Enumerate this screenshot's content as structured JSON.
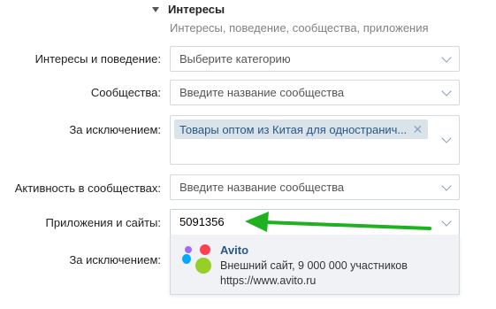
{
  "section": {
    "title": "Интересы",
    "subtitle": "Интересы, поведение, сообщества, приложения"
  },
  "rows": {
    "interests": {
      "label": "Интересы и поведение:",
      "placeholder": "Выберите категорию"
    },
    "communities": {
      "label": "Сообщества:",
      "placeholder": "Введите название сообщества"
    },
    "except1": {
      "label": "За исключением:",
      "token": "Товары оптом из Китая для одностранич..."
    },
    "activity": {
      "label": "Активность в сообществах:",
      "placeholder": "Введите название сообщества"
    },
    "apps": {
      "label": "Приложения и сайты:",
      "value": "5091356"
    },
    "except2": {
      "label": "За исключением:"
    }
  },
  "suggestion": {
    "name": "Avito",
    "description": "Внешний сайт, 9 000 000 участников",
    "url": "https://www.avito.ru",
    "logo_colors": [
      "#ff4053",
      "#0af",
      "#97cf26",
      "#a169f7"
    ]
  },
  "annotation": {
    "arrow_color": "#1fb21f"
  }
}
